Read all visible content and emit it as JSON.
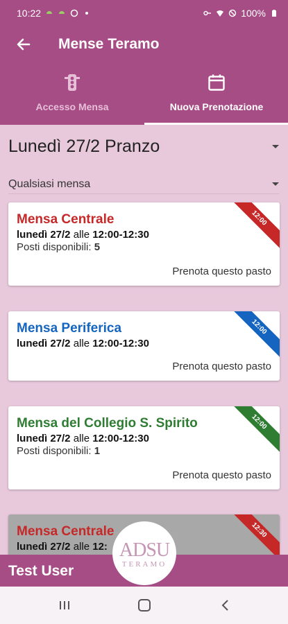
{
  "status_bar": {
    "time": "10:22",
    "battery": "100%",
    "icons": [
      "android-icon",
      "android-icon",
      "circle-icon",
      "dot-icon",
      "key-icon",
      "wifi-icon",
      "dnd-icon",
      "battery-icon"
    ]
  },
  "header": {
    "title": "Mense Teramo",
    "back_icon": "arrow-left-icon"
  },
  "tabs": [
    {
      "label": "Accesso Mensa",
      "icon": "traffic-light-icon",
      "active": false
    },
    {
      "label": "Nuova Prenotazione",
      "icon": "calendar-icon",
      "active": true
    }
  ],
  "meal_select": {
    "value": "Lunedì 27/2 Pranzo"
  },
  "canteen_select": {
    "value": "Qualsiasi mensa"
  },
  "cards": [
    {
      "name": "Mensa Centrale",
      "name_color": "#c62828",
      "date": "lunedì 27/2",
      "alle": "alle",
      "time": "12:00-12:30",
      "seats_label": "Posti disponibili:",
      "seats": "5",
      "book": "Prenota questo pasto",
      "ribbon": "12:00",
      "ribbon_color": "#c62828"
    },
    {
      "name": "Mensa Periferica",
      "name_color": "#1565c0",
      "date": "lunedì 27/2",
      "alle": "alle",
      "time": "12:00-12:30",
      "book": "Prenota questo pasto",
      "ribbon": "12:00",
      "ribbon_color": "#1565c0"
    },
    {
      "name": "Mensa del Collegio S. Spirito",
      "name_color": "#2e7d32",
      "date": "lunedì 27/2",
      "alle": "alle",
      "time": "12:00-12:30",
      "seats_label": "Posti disponibili:",
      "seats": "1",
      "book": "Prenota questo pasto",
      "ribbon": "12:00",
      "ribbon_color": "#2e7d32"
    },
    {
      "name": "Mensa Centrale",
      "name_color": "#c62828",
      "date": "lunedì 27/2",
      "alle": "alle",
      "time": "12:",
      "ribbon": "12:30",
      "ribbon_color": "#c62828"
    }
  ],
  "footer": {
    "user_name": "Test User",
    "logo_main": "ADSU",
    "logo_sub": "TERAMO"
  },
  "colors": {
    "primary": "#a64d86",
    "background": "#e8c9dc"
  }
}
